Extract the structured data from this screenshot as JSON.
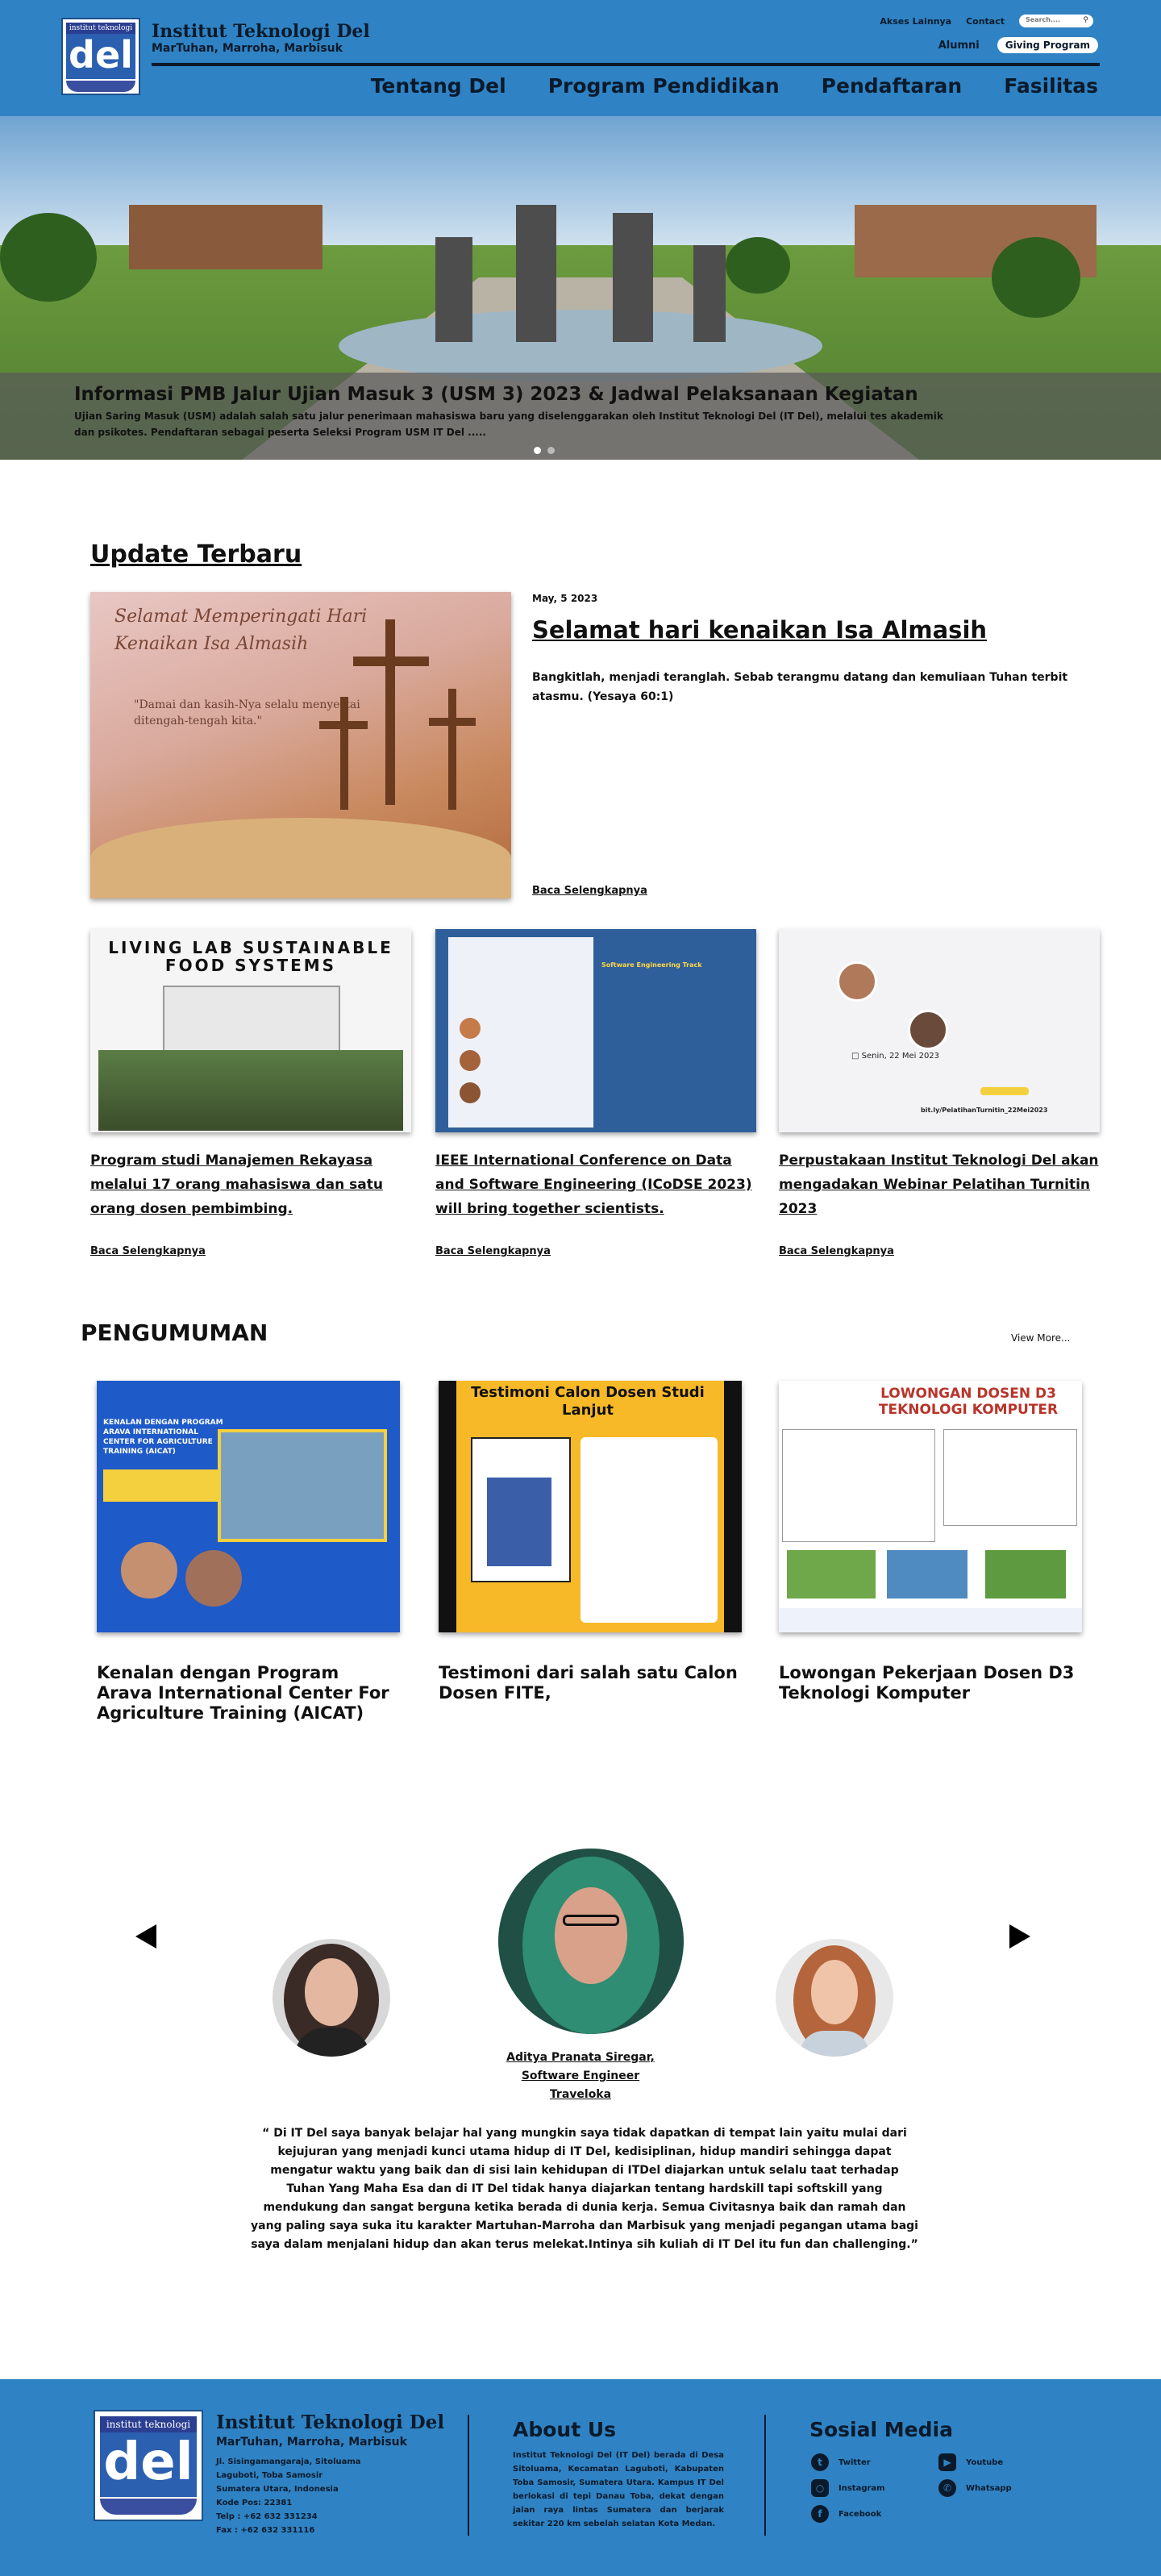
{
  "header": {
    "logo_top": "institut teknologi",
    "logo_word": "del",
    "institution": "Institut Teknologi Del",
    "motto": "MarTuhan, Marroha, Marbisuk",
    "top_links": [
      "Akses Lainnya",
      "Contact"
    ],
    "search_placeholder": "Search....",
    "alumni": "Alumni",
    "giving": "Giving Program",
    "nav": [
      "Tentang Del",
      "Program Pendidikan",
      "Pendaftaran",
      "Fasilitas"
    ]
  },
  "hero": {
    "title": "Informasi PMB Jalur Ujian  Masuk 3 (USM 3) 2023  & Jadwal Pelaksanaan Kegiatan",
    "text": "Ujian Saring  Masuk (USM) adalah salah satu jalur penerimaan mahasiswa baru yang diselenggarakan oleh Institut Teknologi Del (IT Del), melalui tes akademik dan psikotes. Pendaftaran sebagai peserta Seleksi Program USM IT Del ....."
  },
  "update": {
    "section_title": "Update Terbaru",
    "featured": {
      "image_text_1": "Selamat Memperingati Hari",
      "image_text_2": "Kenaikan Isa Almasih",
      "image_quote_1": "\"Damai dan kasih-Nya selalu menyertai",
      "image_quote_2": "ditengah-tengah kita.\"",
      "date": "May, 5 2023",
      "title": "Selamat hari kenaikan Isa Almasih",
      "desc": "Bangkitlah, menjadi teranglah. Sebab terangmu datang dan kemuliaan Tuhan terbit atasmu. (Yesaya 60:1)",
      "more": "Baca Selengkapnya"
    },
    "cards": [
      {
        "image_text": "LIVING LAB SUSTAINABLE FOOD SYSTEMS",
        "title": "Program studi Manajemen Rekayasa melalui 17 orang mahasiswa dan satu orang dosen pembimbing.",
        "more": "Baca Selengkapnya"
      },
      {
        "image_text": "Software Engineering Track",
        "title": "IEEE International Conference on Data and Software Engineering (ICoDSE 2023) will bring together scientists.",
        "more": "Baca Selengkapnya"
      },
      {
        "image_text": "bit.ly/PelatihanTurnitin_22Mei2023",
        "title": "Perpustakaan Institut Teknologi Del akan mengadakan Webinar Pelatihan Turnitin 2023",
        "more": "Baca Selengkapnya"
      }
    ]
  },
  "pengumuman": {
    "section_title": "PENGUMUMAN",
    "view_more": "View More...",
    "cards": [
      {
        "image_text": "KENALAN DENGAN PROGRAM ARAVA INTERNATIONAL CENTER FOR AGRICULTURE TRAINING (AICAT)",
        "title": "Kenalan dengan Program Arava International Center For Agriculture Training (AICAT)"
      },
      {
        "image_text": "Testimoni Calon Dosen Studi Lanjut",
        "title": "Testimoni dari salah satu Calon Dosen FITE,"
      },
      {
        "image_text": "LOWONGAN DOSEN D3 TEKNOLOGI KOMPUTER",
        "title": "Lowongan Pekerjaan Dosen D3 Teknologi Komputer"
      }
    ]
  },
  "testimonial": {
    "name_line1": "Aditya Pranata Siregar,",
    "name_line2": "Software Engineer",
    "name_line3": "Traveloka",
    "quote": "“ Di IT Del saya banyak belajar hal yang mungkin saya tidak dapatkan di tempat lain yaitu mulai dari kejujuran yang menjadi kunci utama hidup di IT Del, kedisiplinan, hidup mandiri sehingga dapat mengatur waktu yang baik dan di sisi lain kehidupan di ITDel diajarkan untuk selalu taat terhadap Tuhan Yang Maha Esa dan di IT Del tidak hanya diajarkan tentang hardskill tapi softskill yang mendukung dan sangat berguna ketika berada di dunia kerja. Semua Civitasnya baik dan ramah dan yang paling saya suka itu karakter Martuhan-Marroha dan Marbisuk yang menjadi pegangan utama bagi saya dalam menjalani hidup dan akan terus melekat.Intinya sih kuliah di IT Del itu fun dan challenging.”"
  },
  "footer": {
    "institution": "Institut Teknologi Del",
    "motto": "MarTuhan, Marroha, Marbisuk",
    "address": "Jl. Sisingamangaraja, Sitoluama\nLaguboti, Toba Samosir\nSumatera Utara, Indonesia\nKode Pos: 22381\nTelp : +62 632 331234\nFax : +62 632 331116",
    "about_title": "About Us",
    "about_text": "Institut Teknologi Del (IT Del) berada di Desa Sitoluama, Kecamatan Laguboti, Kabupaten Toba Samosir, Sumatera Utara. Kampus IT Del berlokasi di tepi Danau Toba, dekat dengan jalan raya lintas Sumatera dan berjarak sekitar 220 km sebelah selatan Kota Medan.",
    "social_title": "Sosial Media",
    "social": [
      "Twitter",
      "Youtube",
      "Instagram",
      "Whatsapp",
      "Facebook"
    ]
  }
}
